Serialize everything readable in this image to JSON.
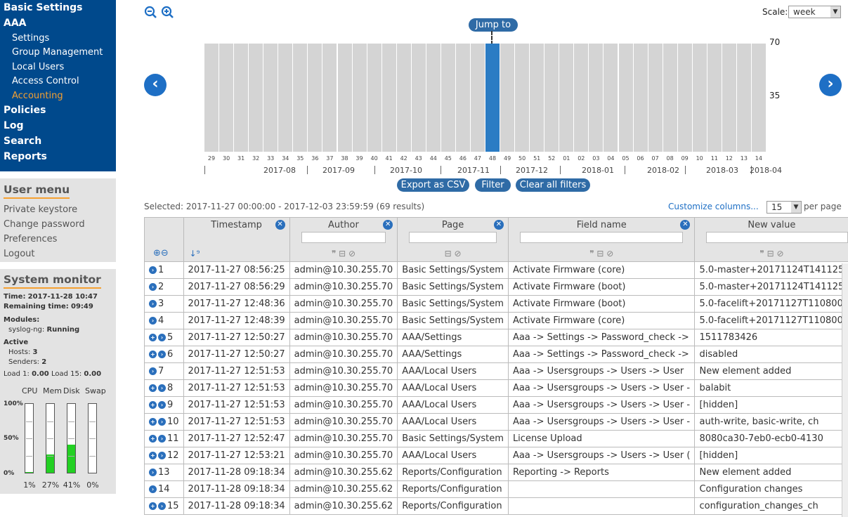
{
  "nav": {
    "basic": "Basic Settings",
    "aaa": "AAA",
    "settings": "Settings",
    "group": "Group Management",
    "local": "Local Users",
    "access": "Access Control",
    "accounting": "Accounting",
    "policies": "Policies",
    "log": "Log",
    "search": "Search",
    "reports": "Reports"
  },
  "user_menu": {
    "title": "User menu",
    "items": [
      "Private keystore",
      "Change password",
      "Preferences",
      "Logout"
    ]
  },
  "sysmon": {
    "title": "System monitor",
    "time_label": "Time:",
    "time": "2017-11-28 10:47",
    "remaining_label": "Remaining time:",
    "remaining": "09:49",
    "modules_label": "Modules:",
    "module_name": "syslog-ng:",
    "module_status": "Running",
    "active_label": "Active",
    "hosts_label": "Hosts:",
    "hosts": "3",
    "senders_label": "Senders:",
    "senders": "2",
    "load1_label": "Load 1:",
    "load1": "0.00",
    "load15_label": "Load 15:",
    "load15": "0.00",
    "meters": [
      {
        "name": "CPU",
        "value": "1%",
        "level": 0.01
      },
      {
        "name": "Mem",
        "value": "27%",
        "level": 0.27
      },
      {
        "name": "Disk",
        "value": "41%",
        "level": 0.41
      },
      {
        "name": "Swap",
        "value": "0%",
        "level": 0.0
      }
    ],
    "p100": "100%",
    "p50": "50%",
    "p0": "0%"
  },
  "timeline": {
    "jump": "Jump to",
    "scale_label": "Scale:",
    "scale_value": "week",
    "y_max": "70",
    "y_mid": "35",
    "weeks": [
      "29",
      "30",
      "31",
      "32",
      "33",
      "34",
      "35",
      "36",
      "37",
      "38",
      "39",
      "40",
      "41",
      "42",
      "43",
      "44",
      "45",
      "46",
      "47",
      "48",
      "49",
      "50",
      "51",
      "52",
      "01",
      "02",
      "03",
      "04",
      "05",
      "06",
      "07",
      "08",
      "09",
      "10",
      "11",
      "12",
      "13",
      "14"
    ],
    "months": [
      "2017-08",
      "2017-09",
      "2017-10",
      "2017-11",
      "2017-12",
      "2018-01",
      "2018-02",
      "2018-03",
      "2018-04"
    ],
    "selected_week": "48",
    "export": "Export as CSV",
    "filter": "Filter",
    "clear": "Clear all filters"
  },
  "selection": {
    "text": "Selected: 2017-11-27 00:00:00 - 2017-12-03 23:59:59 (69 results)",
    "customize": "Customize columns...",
    "per_page_value": "15",
    "per_page_label": "per page"
  },
  "columns": [
    "Timestamp",
    "Author",
    "Page",
    "Field name",
    "New value"
  ],
  "rows": [
    [
      "1",
      "2017-11-27 08:56:25",
      "admin@10.30.255.70",
      "Basic Settings/System",
      "Activate Firmware (core)",
      "5.0-master+20171124T141125"
    ],
    [
      "2",
      "2017-11-27 08:56:29",
      "admin@10.30.255.70",
      "Basic Settings/System",
      "Activate Firmware (boot)",
      "5.0-master+20171124T141125"
    ],
    [
      "3",
      "2017-11-27 12:48:36",
      "admin@10.30.255.70",
      "Basic Settings/System",
      "Activate Firmware (boot)",
      "5.0-facelift+20171127T110800"
    ],
    [
      "4",
      "2017-11-27 12:48:39",
      "admin@10.30.255.70",
      "Basic Settings/System",
      "Activate Firmware (core)",
      "5.0-facelift+20171127T110800"
    ],
    [
      "5",
      "2017-11-27 12:50:27",
      "admin@10.30.255.70",
      "AAA/Settings",
      "Aaa -> Settings -> Password_check -> ",
      "1511783426"
    ],
    [
      "6",
      "2017-11-27 12:50:27",
      "admin@10.30.255.70",
      "AAA/Settings",
      "Aaa -> Settings -> Password_check -> ",
      "disabled"
    ],
    [
      "7",
      "2017-11-27 12:51:53",
      "admin@10.30.255.70",
      "AAA/Local Users",
      "Aaa -> Usersgroups -> Users -> User",
      "New element added"
    ],
    [
      "8",
      "2017-11-27 12:51:53",
      "admin@10.30.255.70",
      "AAA/Local Users",
      "Aaa -> Usersgroups -> Users -> User -",
      "balabit"
    ],
    [
      "9",
      "2017-11-27 12:51:53",
      "admin@10.30.255.70",
      "AAA/Local Users",
      "Aaa -> Usersgroups -> Users -> User -",
      "[hidden]"
    ],
    [
      "10",
      "2017-11-27 12:51:53",
      "admin@10.30.255.70",
      "AAA/Local Users",
      "Aaa -> Usersgroups -> Users -> User -",
      "auth-write, basic-write, ch"
    ],
    [
      "11",
      "2017-11-27 12:52:47",
      "admin@10.30.255.70",
      "Basic Settings/System",
      "License Upload",
      "8080ca30-7eb0-ecb0-4130"
    ],
    [
      "12",
      "2017-11-27 12:53:21",
      "admin@10.30.255.70",
      "AAA/Local Users",
      "Aaa -> Usersgroups -> Users -> User (",
      "[hidden]"
    ],
    [
      "13",
      "2017-11-28 09:18:34",
      "admin@10.30.255.62",
      "Reports/Configuration",
      "Reporting -> Reports",
      "New element added"
    ],
    [
      "14",
      "2017-11-28 09:18:34",
      "admin@10.30.255.62",
      "Reports/Configuration",
      "",
      "Configuration changes"
    ],
    [
      "15",
      "2017-11-28 09:18:34",
      "admin@10.30.255.62",
      "Reports/Configuration",
      "",
      "configuration_changes_ch"
    ]
  ],
  "row_plus": [
    false,
    false,
    false,
    false,
    true,
    true,
    false,
    true,
    true,
    true,
    true,
    true,
    false,
    false,
    true
  ]
}
